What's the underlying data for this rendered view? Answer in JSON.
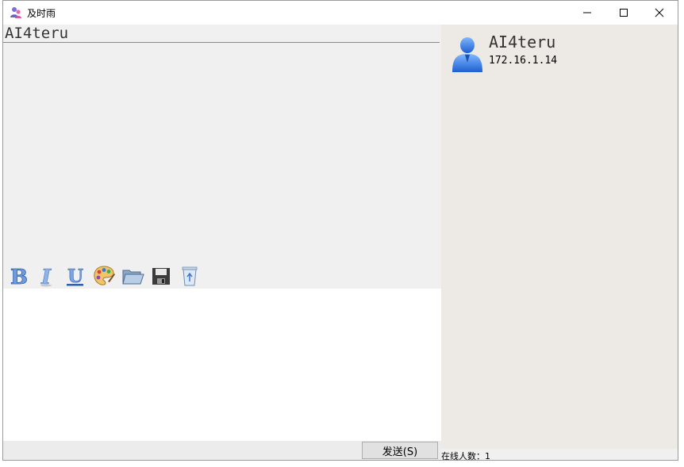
{
  "window": {
    "title": "及时雨",
    "controls": [
      "minimize",
      "maximize",
      "close"
    ]
  },
  "chat": {
    "header_name": "AI4teru",
    "send_label": "发送(S)"
  },
  "toolbar": {
    "icons": [
      "bold-icon",
      "italic-icon",
      "underline-icon",
      "palette-icon",
      "folder-open-icon",
      "save-icon",
      "recycle-bin-icon"
    ]
  },
  "user_panel": {
    "user_name": "AI4teru",
    "user_ip": "172.16.1.14",
    "online_count_label": "在线人数：1"
  },
  "colors": {
    "panel_bg": "#f0f0f0",
    "right_panel_bg": "#ede9e5",
    "input_bg": "#ffffff",
    "icon_blue": "#3a78d8"
  }
}
